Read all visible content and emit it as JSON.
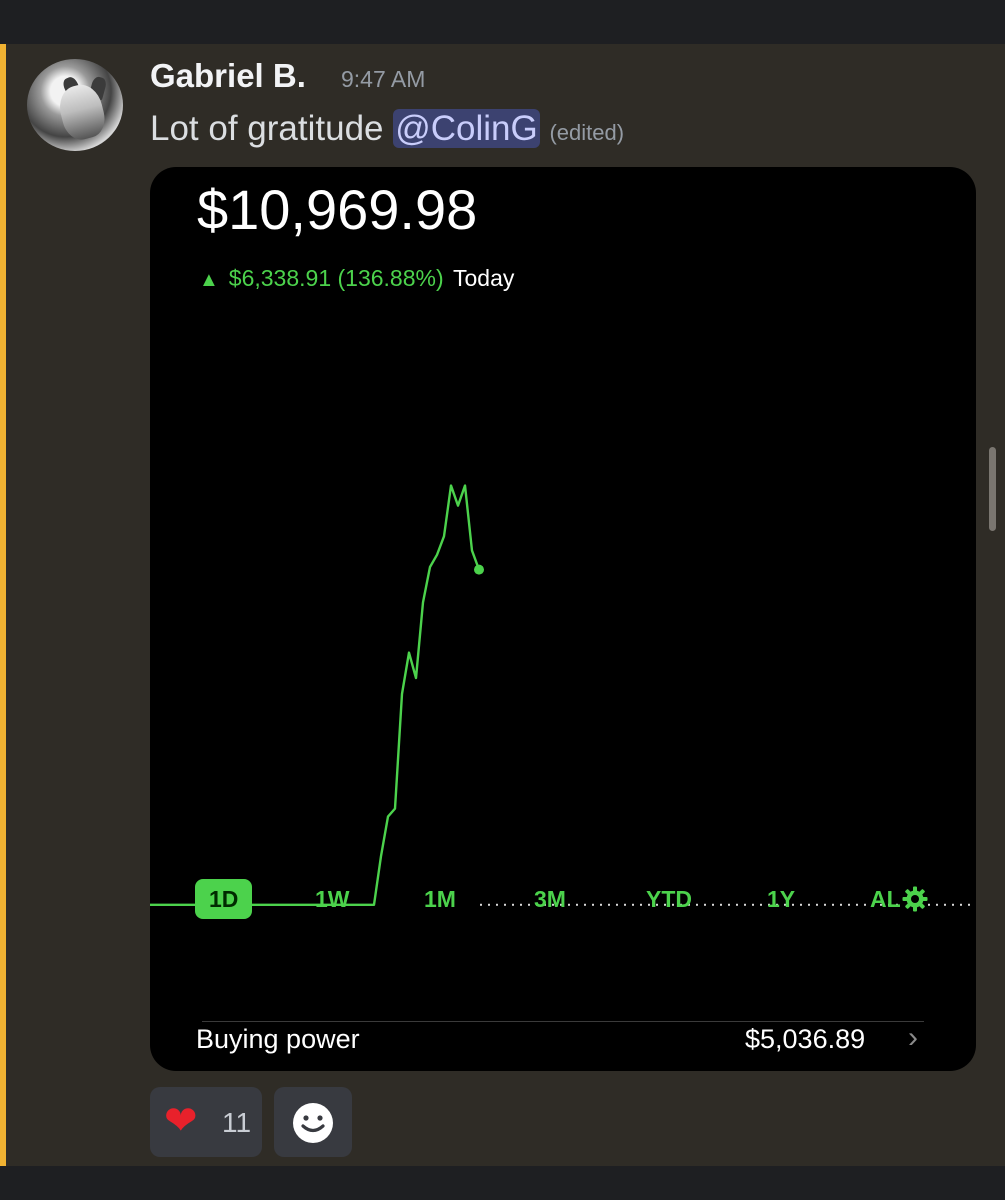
{
  "message": {
    "username": "Gabriel B.",
    "timestamp": "9:47 AM",
    "text": "Lot of gratitude",
    "mention": "@ColinG",
    "edited": "(edited)"
  },
  "portfolio": {
    "balance": "$10,969.98",
    "change": "$6,338.91 (136.88%)",
    "change_period": "Today",
    "periods": [
      "1D",
      "1W",
      "1M",
      "3M",
      "YTD",
      "1Y",
      "AL"
    ],
    "active_period": "1D",
    "buying_power_label": "Buying power",
    "buying_power_value": "$5,036.89",
    "accent_color": "#4cd24c"
  },
  "chart_data": {
    "type": "line",
    "title": "",
    "xlabel": "",
    "ylabel": "",
    "series": [
      {
        "values": [
          4631.07,
          4631.07,
          4631.07,
          4631.07,
          4631.07,
          4631.07,
          4631.07,
          4631.07,
          4631.07,
          4631.07,
          4631.07,
          4631.07,
          4631.07,
          4631.07,
          4631.07,
          4631.07,
          4631.07,
          4631.07,
          4631.07,
          4631.07,
          4631.07,
          4631.07,
          4631.07,
          4631.07,
          4631.07,
          4631.07,
          4631.07,
          4631.07,
          4631.07,
          4631.07,
          4631.07,
          4631.07,
          4631.07,
          5550,
          6300,
          6450,
          8620,
          9400,
          8920,
          10350,
          11020,
          11250,
          11600,
          12560,
          12180,
          12560,
          11330,
          10969.98
        ]
      }
    ],
    "baseline": 4631.07,
    "ylim": [
      4400,
      13100
    ],
    "grid": false,
    "legend": "none"
  },
  "reactions": [
    {
      "icon": "heart-emoji",
      "count": "11"
    },
    {
      "icon": "add-reaction-icon"
    }
  ]
}
